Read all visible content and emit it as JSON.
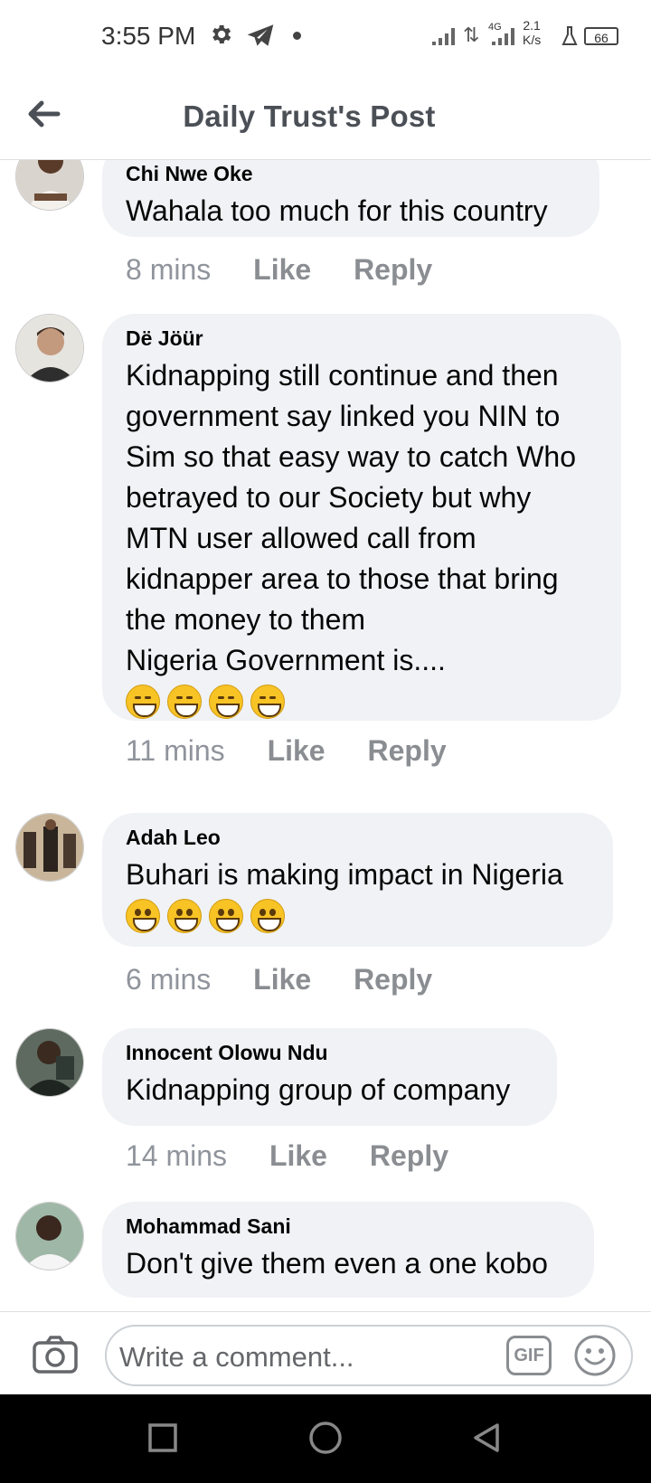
{
  "status_bar": {
    "time": "3:55 PM",
    "network": "4G",
    "speed_value": "2.1",
    "speed_unit": "K/s",
    "battery": "66"
  },
  "header": {
    "title": "Daily Trust's Post",
    "back_icon": "arrow-left-icon"
  },
  "comments": [
    {
      "name": "Chi Nwe Oke",
      "text": "Wahala too much for this country",
      "time": "8 mins",
      "like": "Like",
      "reply": "Reply"
    },
    {
      "name": "Dë Jöür",
      "text": "Kidnapping still continue and then government say linked you NIN to Sim so that easy way to catch Who betrayed to our Society but why MTN user allowed call from kidnapper area to those that bring the money to them\nNigeria Government is....",
      "emoji_count": 4,
      "emoji_type": "grinning-squinting-face",
      "time": "11 mins",
      "like": "Like",
      "reply": "Reply"
    },
    {
      "name": "Adah Leo",
      "text": "Buhari is making impact in Nigeria",
      "emoji_count": 4,
      "emoji_type": "grinning-face",
      "time": "6 mins",
      "like": "Like",
      "reply": "Reply"
    },
    {
      "name": "Innocent Olowu Ndu",
      "text": "Kidnapping group of company",
      "time": "14 mins",
      "like": "Like",
      "reply": "Reply"
    },
    {
      "name": "Mohammad Sani",
      "text": "Don't give them even a one kobo"
    }
  ],
  "composer": {
    "placeholder": "Write a comment...",
    "gif_label": "GIF"
  },
  "colors": {
    "bubble": "#f0f2f5",
    "muted_text": "#90949c",
    "nav_bar": "#000000"
  }
}
